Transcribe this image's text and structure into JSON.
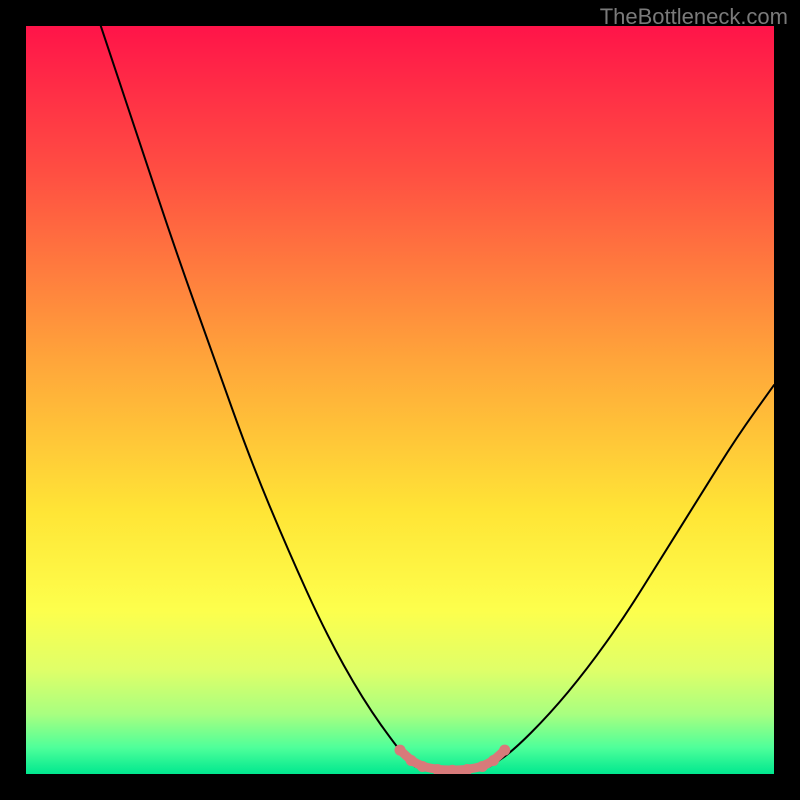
{
  "watermark": {
    "text": "TheBottleneck.com"
  },
  "chart_data": {
    "type": "line",
    "title": "",
    "xlabel": "",
    "ylabel": "",
    "xlim": [
      0,
      100
    ],
    "ylim": [
      0,
      100
    ],
    "background_gradient_stops": [
      {
        "offset": 0.0,
        "color": "#ff1449"
      },
      {
        "offset": 0.2,
        "color": "#ff5042"
      },
      {
        "offset": 0.45,
        "color": "#ffa63a"
      },
      {
        "offset": 0.65,
        "color": "#ffe536"
      },
      {
        "offset": 0.78,
        "color": "#fdff4c"
      },
      {
        "offset": 0.86,
        "color": "#e0ff68"
      },
      {
        "offset": 0.92,
        "color": "#a8ff80"
      },
      {
        "offset": 0.965,
        "color": "#4eff9a"
      },
      {
        "offset": 1.0,
        "color": "#00e88f"
      }
    ],
    "series": [
      {
        "name": "curve-left",
        "stroke": "#000000",
        "strokeWidth": 2,
        "x": [
          10,
          15,
          20,
          25,
          30,
          35,
          40,
          45,
          50,
          52
        ],
        "values": [
          100,
          85,
          70,
          56,
          42,
          30,
          19,
          10,
          3,
          1
        ]
      },
      {
        "name": "curve-right",
        "stroke": "#000000",
        "strokeWidth": 2,
        "x": [
          62,
          65,
          70,
          75,
          80,
          85,
          90,
          95,
          100
        ],
        "values": [
          1,
          3,
          8,
          14,
          21,
          29,
          37,
          45,
          52
        ]
      },
      {
        "name": "highlight-bottom",
        "stroke": "#d87a7a",
        "strokeWidth": 9,
        "x": [
          50,
          51.5,
          53,
          55,
          57,
          59,
          61,
          62.5,
          64
        ],
        "values": [
          3.2,
          1.8,
          1.0,
          0.6,
          0.5,
          0.6,
          1.0,
          1.8,
          3.2
        ],
        "dots_x": [
          50,
          51.5,
          53,
          55,
          57,
          59,
          61,
          62.5,
          64
        ],
        "dots_values": [
          3.2,
          1.8,
          1.0,
          0.6,
          0.5,
          0.6,
          1.0,
          1.8,
          3.2
        ],
        "dot_radius": 5.5
      }
    ]
  }
}
